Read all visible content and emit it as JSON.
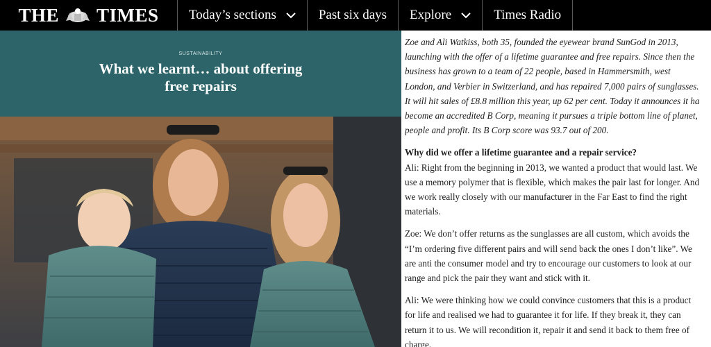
{
  "nav": {
    "logo": "THE TIMES",
    "items": [
      {
        "label": "Today’s sections",
        "dropdown": true
      },
      {
        "label": "Past six days",
        "dropdown": false
      },
      {
        "label": "Explore",
        "dropdown": true
      },
      {
        "label": "Times Radio",
        "dropdown": false
      }
    ]
  },
  "hero": {
    "kicker": "SUSTAINABILITY",
    "headline": "What we learnt… about offering free repairs",
    "bg_color": "#2c6469"
  },
  "article": {
    "standfirst_lines": [
      "Zoe and Ali Watkiss, both 35, founded the eyewear brand SunGod in 2013,",
      "launching with the offer of a lifetime guarantee and free repairs. Since then the",
      "business has grown to a team of 22 people, based in Hammersmith, west",
      "London, and Verbier in Switzerland, and has repaired 7,000 pairs of sunglasses.",
      "It will hit sales of £8.8 million this year, up 62 per cent. Today it announces it ha",
      "become an accredited B Corp, meaning it pursues a triple bottom line of planet,",
      "people and profit. Its B Corp score was 93.7 out of 200."
    ],
    "question": "Why did we offer a lifetime guarantee and a repair service?",
    "para1_lines": [
      "Ali: Right from the beginning in 2013, we wanted a product that would last. We",
      "use a memory polymer that is flexible, which makes the pair last for longer. And",
      "we work really closely with our manufacturer in the Far East to find the right",
      "materials."
    ],
    "para2_lines": [
      "Zoe: We don’t offer returns as the sunglasses are all custom, which avoids the",
      "“I’m ordering five different pairs and will send back the ones I don’t like”. We",
      "are anti the consumer model and try to encourage our customers to look at our",
      "range and pick the pair they want and stick with it."
    ],
    "para3_lines": [
      "Ali: We were thinking how we could convince customers that this is a product",
      "for life and realised we had to guarantee it for life. If they break it, they can",
      "return it to us. We will recondition it, repair it and send it back to them free of",
      "charge."
    ]
  }
}
